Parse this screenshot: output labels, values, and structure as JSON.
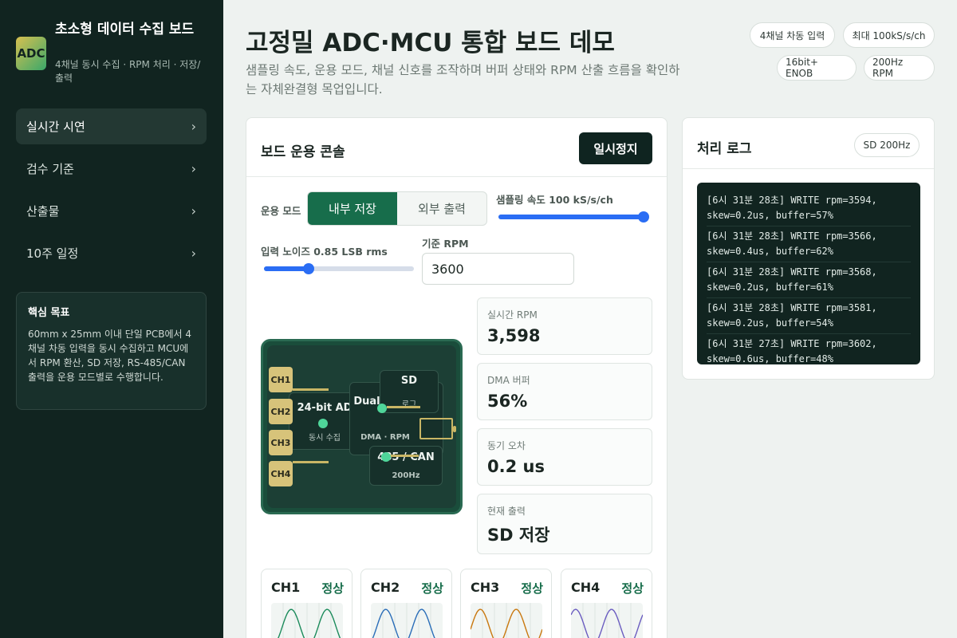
{
  "brand": {
    "logo": "ADC",
    "title": "초소형 데이터 수집 보드",
    "subtitle": "4채널 동시 수집 · RPM 처리 · 저장/출력"
  },
  "nav": [
    {
      "label": "실시간 시연",
      "active": true
    },
    {
      "label": "검수 기준",
      "active": false
    },
    {
      "label": "산출물",
      "active": false
    },
    {
      "label": "10주 일정",
      "active": false
    }
  ],
  "goal": {
    "title": "핵심 목표",
    "text": "60mm x 25mm 이내 단일 PCB에서 4채널 차동 입력을 동시 수집하고 MCU에서 RPM 환산, SD 저장, RS-485/CAN 출력을 운용 모드별로 수행합니다."
  },
  "header": {
    "title": "고정밀 ADC·MCU 통합 보드 데모",
    "desc": "샘플링 속도, 운용 모드, 채널 신호를 조작하며 버퍼 상태와 RPM 산출 흐름을 확인하는 자체완결형 목업입니다.",
    "chips": [
      "4채널 차동 입력",
      "최대 100kS/s/ch",
      "16bit+ ENOB",
      "200Hz RPM"
    ]
  },
  "console": {
    "title": "보드 운용 콘솔",
    "pause_label": "일시정지",
    "mode_label": "운용 모드",
    "modes": [
      "내부 저장",
      "외부 출력"
    ],
    "sample_label": "샘플링 속도 100 kS/s/ch",
    "sample_fraction": 1.0,
    "noise_label": "입력 노이즈 0.85 LSB rms",
    "noise_fraction": 0.3,
    "rpm_label": "기준 RPM",
    "rpm_value": "3600"
  },
  "board": {
    "channels": [
      "CH1",
      "CH2",
      "CH3",
      "CH4"
    ],
    "adc_title": "24-bit AD",
    "adc_sub": "동시 수집",
    "mcu_title": "Dual",
    "mcu_sub": "DMA · RPM",
    "sd_title": "SD",
    "sd_sub": "로그",
    "bus_title": "485 / CAN",
    "bus_sub": "200Hz"
  },
  "metrics": [
    {
      "label": "실시간 RPM",
      "value": "3,598"
    },
    {
      "label": "DMA 버퍼",
      "value": "56%"
    },
    {
      "label": "동기 오차",
      "value": "0.2 us"
    },
    {
      "label": "현재 출력",
      "value": "SD 저장"
    }
  ],
  "channel_cards": [
    {
      "name": "CH1",
      "status": "정상",
      "color": "#1a8a5a"
    },
    {
      "name": "CH2",
      "status": "정상",
      "color": "#2a6db8"
    },
    {
      "name": "CH3",
      "status": "정상",
      "color": "#c9780f"
    },
    {
      "name": "CH4",
      "status": "정상",
      "color": "#6a5cc0"
    }
  ],
  "log": {
    "title": "처리 로그",
    "badge": "SD 200Hz",
    "lines": [
      "[6시 31분 28초] WRITE rpm=3594, skew=0.2us, buffer=57%",
      "[6시 31분 28초] WRITE rpm=3566, skew=0.4us, buffer=62%",
      "[6시 31분 28초] WRITE rpm=3568, skew=0.2us, buffer=61%",
      "[6시 31분 28초] WRITE rpm=3581, skew=0.2us, buffer=54%",
      "[6시 31분 27초] WRITE rpm=3602, skew=0.6us, buffer=48%"
    ]
  }
}
